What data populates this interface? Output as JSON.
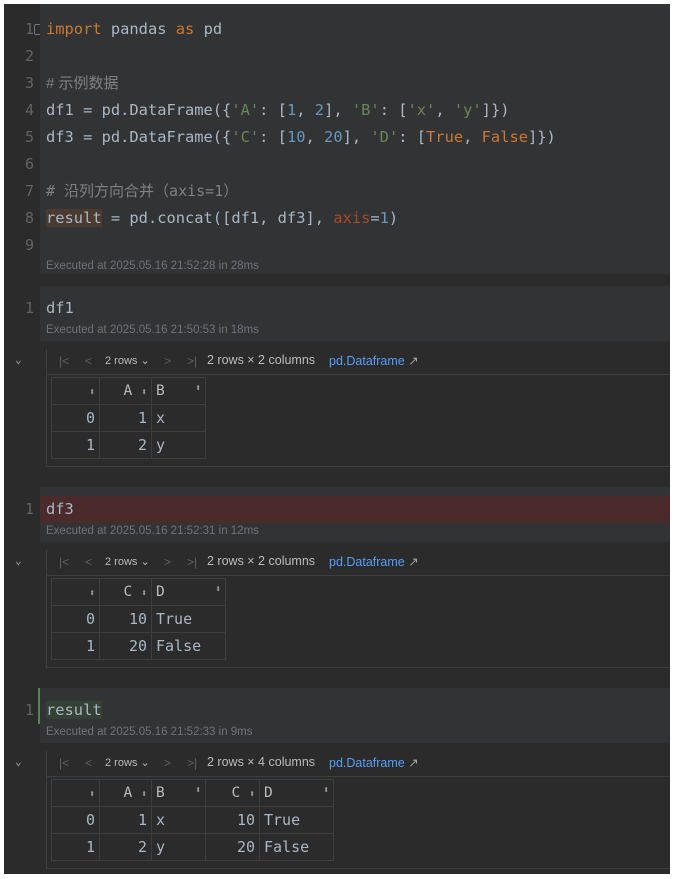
{
  "cell1": {
    "line_numbers": [
      "1",
      "2",
      "3",
      "4",
      "5",
      "6",
      "7",
      "8",
      "9"
    ],
    "code": {
      "l1_import": "import",
      "l1_pandas": " pandas ",
      "l1_as": "as",
      "l1_pd": " pd",
      "l3_comment": "# 示例数据",
      "l4_a": "df1 = pd.DataFrame({",
      "l4_b": "'A'",
      "l4_c": ": [",
      "l4_d": "1",
      "l4_e": ", ",
      "l4_f": "2",
      "l4_g": "], ",
      "l4_h": "'B'",
      "l4_i": ": [",
      "l4_j": "'x'",
      "l4_k": ", ",
      "l4_l": "'y'",
      "l4_m": "]})",
      "l5_a": "df3 = pd.DataFrame({",
      "l5_b": "'C'",
      "l5_c": ": [",
      "l5_d": "10",
      "l5_e": ", ",
      "l5_f": "20",
      "l5_g": "], ",
      "l5_h": "'D'",
      "l5_i": ": [",
      "l5_j": "True",
      "l5_k": ", ",
      "l5_l": "False",
      "l5_m": "]})",
      "l7_comment": "# 沿列方向合并（axis=1）",
      "l8_result": "result",
      "l8_b": " = pd.concat([df1, df3], ",
      "l8_axis": "axis",
      "l8_eq": "=",
      "l8_one": "1",
      "l8_close": ")"
    },
    "executed": "Executed at 2025.05.16 21:52:28 in 28ms"
  },
  "cell2": {
    "line_number": "1",
    "code": "df1",
    "executed": "Executed at 2025.05.16 21:50:53 in 18ms",
    "output": {
      "rows_label": "2 rows",
      "info": "2 rows × 2 columns",
      "link": "pd.Dataframe",
      "columns": [
        "A",
        "B"
      ],
      "rows": [
        {
          "index": "0",
          "cells": [
            "1",
            "x"
          ]
        },
        {
          "index": "1",
          "cells": [
            "2",
            "y"
          ]
        }
      ]
    }
  },
  "cell3": {
    "line_number": "1",
    "code": "df3",
    "executed": "Executed at 2025.05.16 21:52:31 in 12ms",
    "output": {
      "rows_label": "2 rows",
      "info": "2 rows × 2 columns",
      "link": "pd.Dataframe",
      "columns": [
        "C",
        "D"
      ],
      "rows": [
        {
          "index": "0",
          "cells": [
            "10",
            "True"
          ]
        },
        {
          "index": "1",
          "cells": [
            "20",
            "False"
          ]
        }
      ]
    }
  },
  "cell4": {
    "line_number": "1",
    "code": "result",
    "executed": "Executed at 2025.05.16 21:52:33 in 9ms",
    "output": {
      "rows_label": "2 rows",
      "info": "2 rows × 4 columns",
      "link": "pd.Dataframe",
      "columns": [
        "A",
        "B",
        "C",
        "D"
      ],
      "rows": [
        {
          "index": "0",
          "cells": [
            "1",
            "x",
            "10",
            "True"
          ]
        },
        {
          "index": "1",
          "cells": [
            "2",
            "y",
            "20",
            "False"
          ]
        }
      ]
    }
  },
  "icons": {
    "sort": "⬍",
    "first": "|<",
    "prev": "<",
    "next": ">",
    "last": ">|",
    "chevron": "⌄",
    "collapse": "⌄",
    "external": "↗"
  },
  "colors": {
    "background": "#2b2b2b",
    "cell_background": "#313335",
    "keyword": "#cc7832",
    "string": "#6a8759",
    "number": "#6897bb",
    "link": "#589df6",
    "error_highlight": "#4a2a2a",
    "active_bar": "#4e8a4e"
  }
}
